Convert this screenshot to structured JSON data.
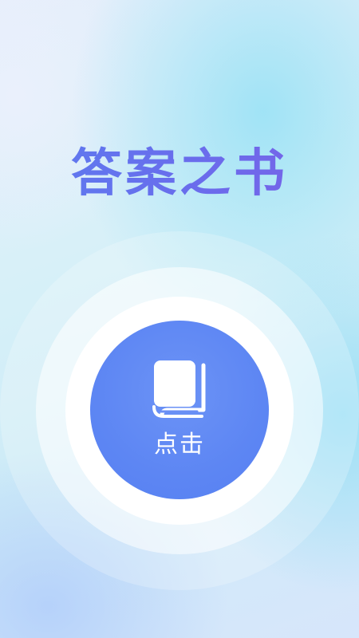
{
  "app": {
    "title": "答案之书"
  },
  "main_button": {
    "label": "点击",
    "icon": "book-icon",
    "color": "#5d86f3"
  },
  "colors": {
    "title_gradient_start": "#5b7df0",
    "title_gradient_end": "#7b61e6",
    "ring": "#ffffff"
  }
}
